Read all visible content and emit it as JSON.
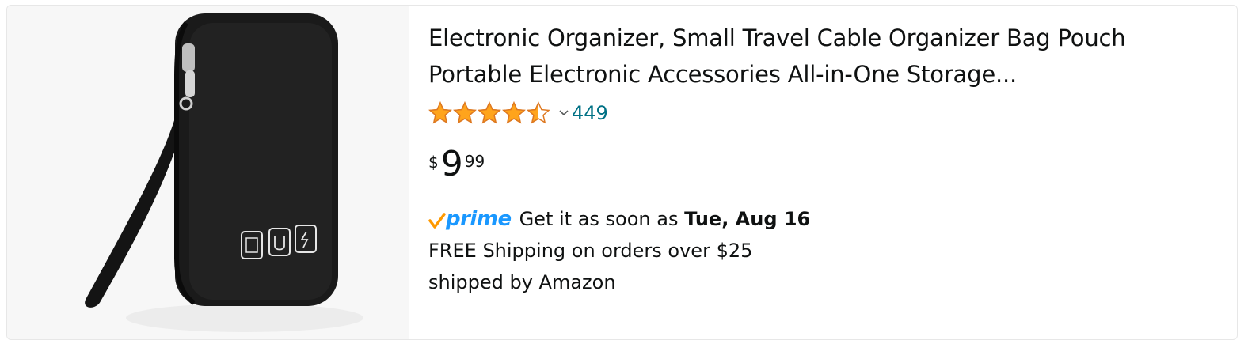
{
  "product": {
    "title_line1": "Electronic Organizer, Small Travel Cable Organizer Bag Pouch",
    "title_line2": "Portable Electronic Accessories All-in-One Storage...",
    "rating": 4.5,
    "rating_max": 5,
    "review_count": "449",
    "price": {
      "symbol": "$",
      "whole": "9",
      "fraction": "99"
    },
    "prime_label": "prime",
    "delivery_prefix": "Get it as soon as",
    "delivery_date": "Tue, Aug 16",
    "shipping_text": "FREE Shipping on orders over $25",
    "shipped_by_text": "shipped by Amazon"
  },
  "colors": {
    "star": "#ffa41c",
    "link": "#007185",
    "prime_blue": "#1a98ff",
    "prime_check": "#ff9900",
    "text": "#0f1111"
  },
  "icons": [
    "star-icon",
    "chevron-down-icon",
    "prime-check-icon"
  ]
}
